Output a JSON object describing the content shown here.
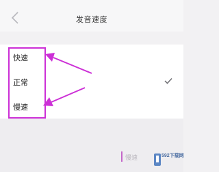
{
  "header": {
    "title": "发音速度",
    "back_icon": "chevron-left-icon"
  },
  "options": [
    {
      "label": "快速",
      "selected": false
    },
    {
      "label": "正常",
      "selected": true
    },
    {
      "label": "慢速",
      "selected": false
    }
  ],
  "bottom": {
    "selected_label": "慢速"
  },
  "watermark": {
    "text": "592下载网"
  },
  "colors": {
    "annotation": "#cc2fd6",
    "background": "#f2f1f3",
    "list_background": "#ffffff"
  }
}
